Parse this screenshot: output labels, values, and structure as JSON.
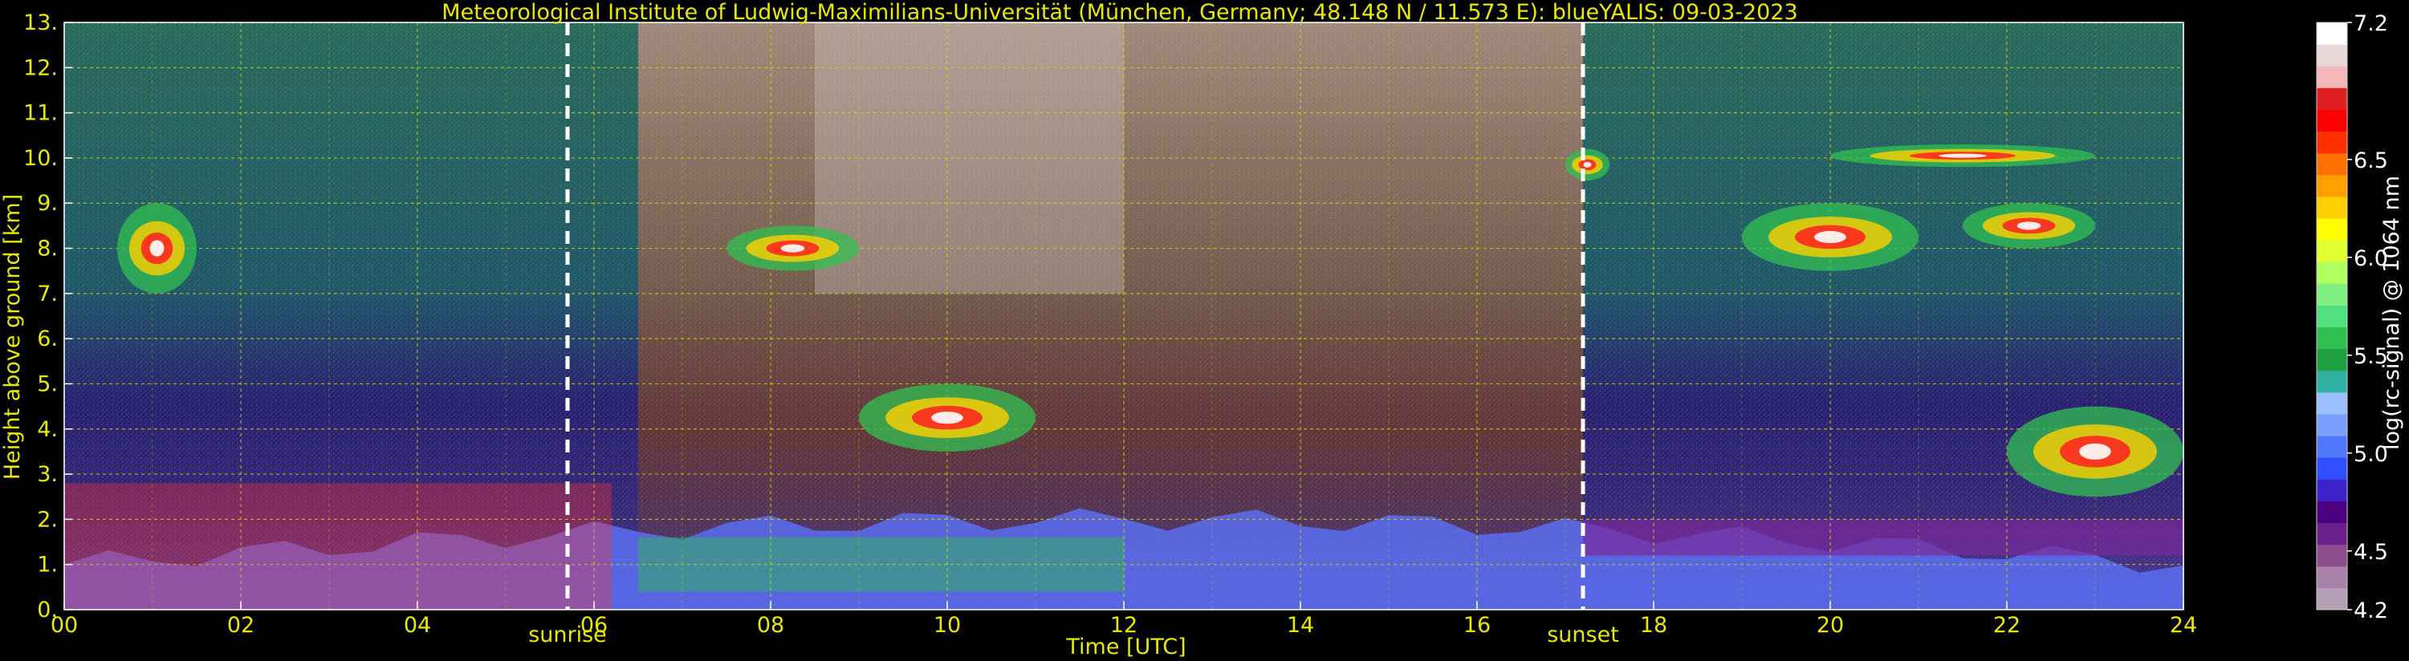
{
  "chart_data": {
    "type": "heatmap",
    "title": "Meteorological Institute of Ludwig-Maximilians-Universität (München, Germany; 48.148 N / 11.573 E):     blueYALIS: 09-03-2023",
    "xlabel": "Time [UTC]",
    "ylabel": "Height above ground [km]",
    "xlim": [
      0,
      24
    ],
    "ylim": [
      0,
      13
    ],
    "x_ticks": [
      "00",
      "02",
      "04",
      "06",
      "08",
      "10",
      "12",
      "14",
      "16",
      "18",
      "20",
      "22",
      "24"
    ],
    "x_tick_values": [
      0,
      2,
      4,
      6,
      8,
      10,
      12,
      14,
      16,
      18,
      20,
      22,
      24
    ],
    "y_ticks": [
      "0.",
      "1.",
      "2.",
      "3.",
      "4.",
      "5.",
      "6.",
      "7.",
      "8.",
      "9.",
      "10.",
      "11.",
      "12.",
      "13."
    ],
    "y_tick_values": [
      0,
      1,
      2,
      3,
      4,
      5,
      6,
      7,
      8,
      9,
      10,
      11,
      12,
      13
    ],
    "grid": true,
    "annotations": [
      {
        "text": "sunrise",
        "x": 5.7
      },
      {
        "text": "sunset",
        "x": 17.2
      }
    ],
    "colorbar": {
      "label": "log(rc-signal) @ 1064 nm",
      "min": 4.2,
      "max": 7.2,
      "ticks": [
        "4.2",
        "4.5",
        "5.0",
        "5.5",
        "6.0",
        "6.5",
        "7.2"
      ],
      "tick_values": [
        4.2,
        4.5,
        5.0,
        5.5,
        6.0,
        6.5,
        7.2
      ],
      "colors": [
        "#b5a0b5",
        "#a882a8",
        "#8c4b8c",
        "#6a1f8a",
        "#4b0082",
        "#3a22c8",
        "#3050ff",
        "#5078ff",
        "#7aa0ff",
        "#9cc0ff",
        "#30b0a0",
        "#20a040",
        "#30c050",
        "#50e080",
        "#80f080",
        "#b0ff60",
        "#e0ff30",
        "#ffff00",
        "#ffd000",
        "#ffa000",
        "#ff7000",
        "#ff3000",
        "#ff0000",
        "#e02020",
        "#f4b8b8",
        "#e8d8d8",
        "#ffffff"
      ]
    },
    "features": [
      {
        "kind": "boundary_layer_aerosol",
        "x": [
          0,
          24
        ],
        "y_top": [
          1.0,
          2.0
        ]
      },
      {
        "kind": "cloud",
        "x": [
          0.6,
          1.5
        ],
        "y": [
          7.0,
          9.0
        ]
      },
      {
        "kind": "cloud",
        "x": [
          7.5,
          9.0
        ],
        "y": [
          7.5,
          8.5
        ]
      },
      {
        "kind": "cloud",
        "x": [
          9.0,
          11.0
        ],
        "y": [
          3.5,
          5.0
        ]
      },
      {
        "kind": "cloud",
        "x": [
          17.0,
          17.5
        ],
        "y": [
          9.5,
          10.2
        ]
      },
      {
        "kind": "cloud",
        "x": [
          19.0,
          21.0
        ],
        "y": [
          7.5,
          9.0
        ]
      },
      {
        "kind": "cloud",
        "x": [
          21.5,
          23.0
        ],
        "y": [
          8.0,
          9.0
        ]
      },
      {
        "kind": "cloud",
        "x": [
          20.0,
          23.0
        ],
        "y": [
          9.8,
          10.3
        ]
      },
      {
        "kind": "cloud",
        "x": [
          22.0,
          24.0
        ],
        "y": [
          2.5,
          4.5
        ]
      }
    ]
  }
}
